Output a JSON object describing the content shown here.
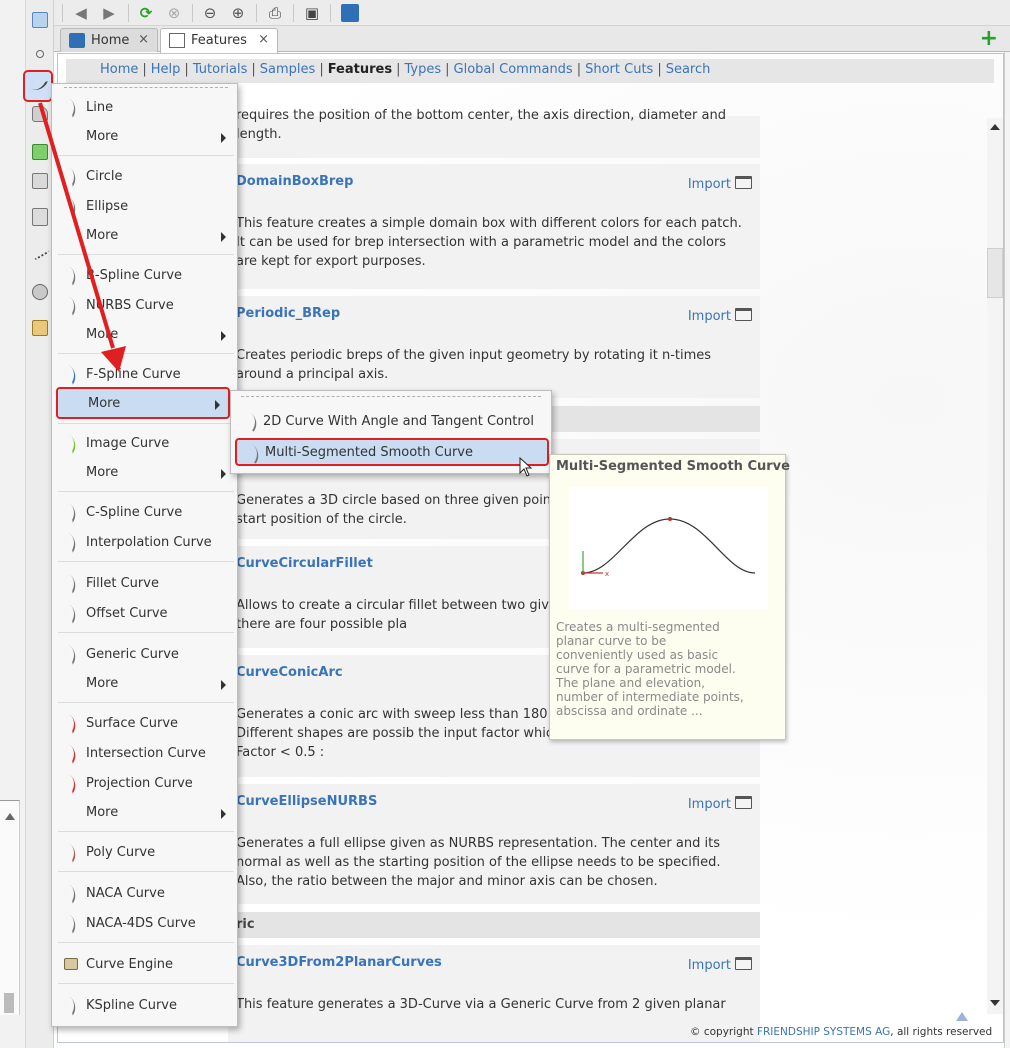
{
  "tabs": [
    {
      "label": "Home",
      "close": "×"
    },
    {
      "label": "Features",
      "close": "×"
    }
  ],
  "add_tab_symbol": "+",
  "nav": {
    "links": [
      "Home",
      "Help",
      "Tutorials",
      "Samples",
      "Features",
      "Types",
      "Global Commands",
      "Short Cuts",
      "Search"
    ],
    "current": "Features",
    "separator": "|"
  },
  "doc": {
    "intro_text": "requires the position of the bottom center, the axis direction, diameter and length.",
    "import_label": "Import",
    "features": [
      {
        "title": "DomainBoxBrep",
        "import": true,
        "desc": "This feature creates a simple domain box with different colors for each patch. It can be used for brep intersection with a parametric model and the colors are kept for export purposes."
      },
      {
        "title": "Periodic_BRep",
        "import": true,
        "desc": "Creates periodic breps of the given input geometry by rotating it n-times around a principal axis."
      },
      {
        "title": "",
        "import": false,
        "desc": "Generates a 3D circle based on three given points. first point provides the start position of the circle."
      },
      {
        "title": "CurveCircularFillet",
        "import": false,
        "desc": "Allows to create a circular fillet between two given that cross each other, there are four possible pla"
      },
      {
        "title": "CurveConicArc",
        "import": false,
        "desc": "Generates a conic arc with sweep less than 180 d given as NURBS curve. Different shapes are possib the input factor which must run between [0,1]: Factor < 0.5 :"
      },
      {
        "title": "CurveEllipseNURBS",
        "import": true,
        "desc": "Generates a full ellipse given as NURBS representation. The center and its normal as well as the starting position of the ellipse needs to be specified. Also, the ratio between the major and minor axis can be chosen."
      },
      {
        "title": "Curve3DFrom2PlanarCurves",
        "import": true,
        "desc": "This feature generates a 3D-Curve via a Generic Curve from 2 given planar"
      }
    ],
    "section_label": "ric",
    "copyright_prefix": "© copyright",
    "company": "FRIENDSHIP SYSTEMS AG",
    "copyright_suffix": ", all rights reserved"
  },
  "menu": {
    "items": [
      {
        "label": "Line",
        "sub": false
      },
      {
        "label": "More",
        "sub": true
      },
      {
        "label": "Circle",
        "sub": false
      },
      {
        "label": "Ellipse",
        "sub": false
      },
      {
        "label": "More",
        "sub": true
      },
      {
        "label": "B-Spline Curve",
        "sub": false
      },
      {
        "label": "NURBS Curve",
        "sub": false
      },
      {
        "label": "More",
        "sub": true
      },
      {
        "label": "F-Spline Curve",
        "sub": false
      },
      {
        "label": "More",
        "sub": true,
        "highlight": true
      },
      {
        "label": "Image Curve",
        "sub": false
      },
      {
        "label": "More",
        "sub": true
      },
      {
        "label": "C-Spline Curve",
        "sub": false
      },
      {
        "label": "Interpolation Curve",
        "sub": false
      },
      {
        "label": "Fillet Curve",
        "sub": false
      },
      {
        "label": "Offset Curve",
        "sub": false
      },
      {
        "label": "Generic Curve",
        "sub": false
      },
      {
        "label": "More",
        "sub": true
      },
      {
        "label": "Surface Curve",
        "sub": false
      },
      {
        "label": "Intersection Curve",
        "sub": false
      },
      {
        "label": "Projection Curve",
        "sub": false
      },
      {
        "label": "More",
        "sub": true
      },
      {
        "label": "Poly Curve",
        "sub": false
      },
      {
        "label": "NACA Curve",
        "sub": false
      },
      {
        "label": "NACA-4DS Curve",
        "sub": false
      },
      {
        "label": "Curve Engine",
        "sub": false
      },
      {
        "label": "KSpline Curve",
        "sub": false
      }
    ]
  },
  "submenu": {
    "items": [
      {
        "label": "2D Curve With Angle and Tangent Control"
      },
      {
        "label": "Multi-Segmented Smooth Curve"
      }
    ]
  },
  "tooltip": {
    "title": "Multi-Segmented Smooth Curve",
    "description": "Creates a multi-segmented planar curve to be conveniently used as basic curve for a parametric model. The plane and elevation, number of intermediate points, abscissa and ordinate ...",
    "axis_x": "x"
  },
  "colors": {
    "accent": "#3a74b8",
    "highlight_border": "#e02020",
    "highlight_fill": "#c9dcf2"
  }
}
